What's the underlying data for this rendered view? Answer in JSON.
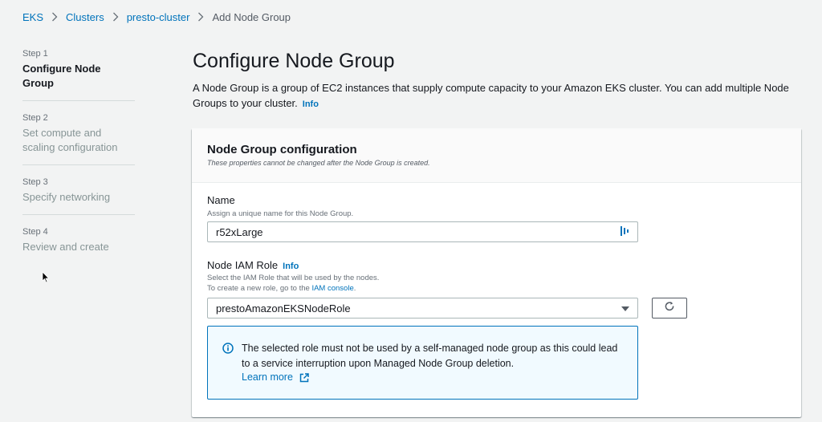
{
  "breadcrumb": [
    {
      "label": "EKS"
    },
    {
      "label": "Clusters"
    },
    {
      "label": "presto-cluster"
    },
    {
      "label": "Add Node Group"
    }
  ],
  "steps": [
    {
      "num": "Step 1",
      "title": "Configure Node Group"
    },
    {
      "num": "Step 2",
      "title": "Set compute and scaling configuration"
    },
    {
      "num": "Step 3",
      "title": "Specify networking"
    },
    {
      "num": "Step 4",
      "title": "Review and create"
    }
  ],
  "page": {
    "title": "Configure Node Group",
    "description": "A Node Group is a group of EC2 instances that supply compute capacity to your Amazon EKS cluster. You can add multiple Node Groups to your cluster.",
    "info_label": "Info"
  },
  "card": {
    "title": "Node Group configuration",
    "subtitle": "These properties cannot be changed after the Node Group is created."
  },
  "name_field": {
    "label": "Name",
    "description": "Assign a unique name for this Node Group.",
    "value": "r52xLarge"
  },
  "role_field": {
    "label": "Node IAM Role",
    "info_label": "Info",
    "description1": "Select the IAM Role that will be used by the nodes.",
    "description2_prefix": "To create a new role, go to the ",
    "description2_link": "IAM console",
    "description2_suffix": ".",
    "selected": "prestoAmazonEKSNodeRole"
  },
  "alert": {
    "text": "The selected role must not be used by a self-managed node group as this could lead to a service interruption upon Managed Node Group deletion.",
    "link": "Learn more"
  },
  "colors": {
    "link": "#0073bb",
    "info_border": "#0073bb",
    "info_bg": "#f1faff"
  }
}
